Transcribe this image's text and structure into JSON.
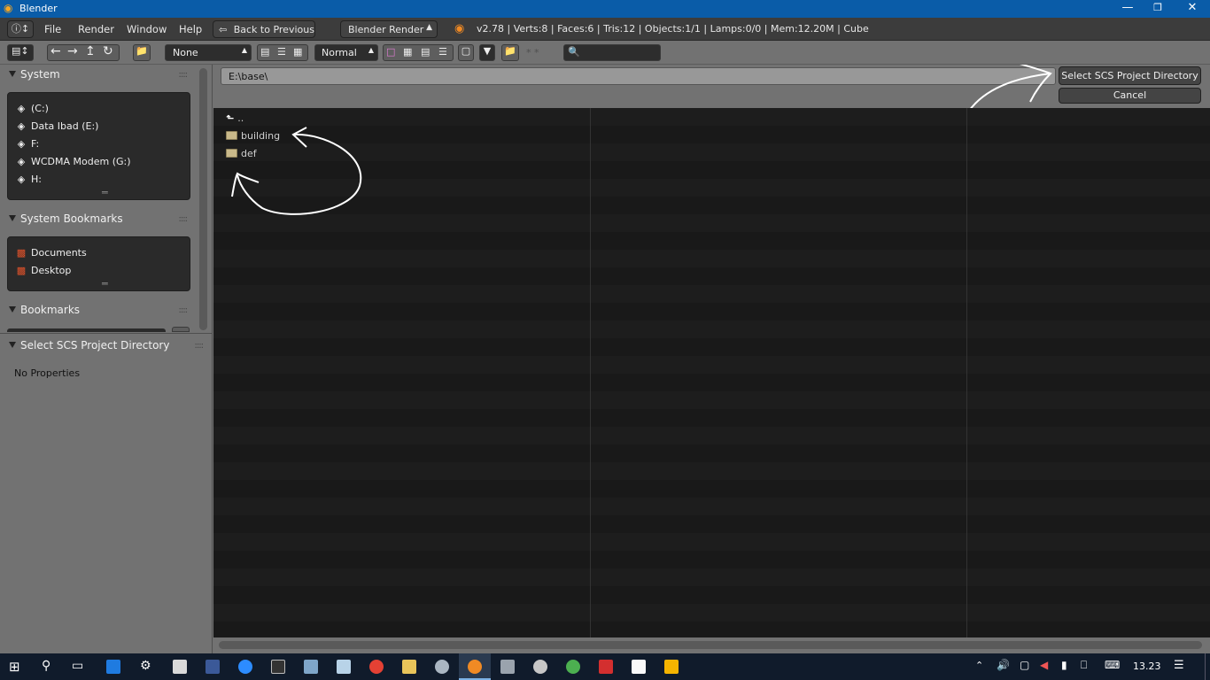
{
  "titlebar": {
    "title": "Blender"
  },
  "infobar": {
    "menus": [
      "File",
      "Render",
      "Window",
      "Help"
    ],
    "back_button": "Back to Previous",
    "render_engine": "Blender Render",
    "stats": "v2.78 | Verts:8 | Faces:6 | Tris:12 | Objects:1/1 | Lamps:0/0 | Mem:12.20M | Cube"
  },
  "fb_header": {
    "recursion": "None",
    "display_size": "Normal",
    "filter_text": "* *"
  },
  "sidebar": {
    "system": {
      "title": "System",
      "items": [
        "(C:)",
        "Data Ibad (E:)",
        "F:",
        "WCDMA Modem (G:)",
        "H:"
      ]
    },
    "system_bookmarks": {
      "title": "System Bookmarks",
      "items": [
        "Documents",
        "Desktop"
      ]
    },
    "bookmarks": {
      "title": "Bookmarks"
    },
    "operator": {
      "title": "Select SCS Project Directory",
      "no_props": "No Properties"
    }
  },
  "path": {
    "value": "E:\\base\\"
  },
  "actions": {
    "select": "Select SCS Project Directory",
    "cancel": "Cancel"
  },
  "files": {
    "parent": "..",
    "items": [
      "building",
      "def"
    ]
  },
  "taskbar": {
    "time": "13.23"
  }
}
